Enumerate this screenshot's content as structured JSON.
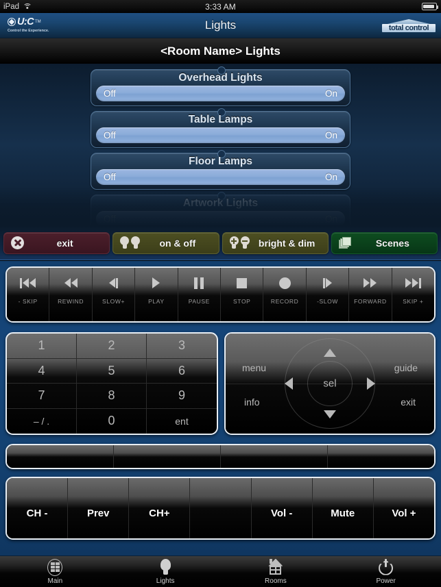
{
  "statusbar": {
    "device": "iPad",
    "time": "3:33 AM",
    "wifi_icon": "wifi-icon",
    "battery_icon": "battery-icon"
  },
  "titlebar": {
    "title": "Lights",
    "brand_letters": "U:C",
    "brand_tm": "TM",
    "brand_tagline": "Control the Experience.",
    "partner_logo_text": "total control"
  },
  "room_header": {
    "title": "<Room Name> Lights"
  },
  "lights": {
    "items": [
      {
        "name": "Overhead Lights",
        "off_label": "Off",
        "on_label": "On",
        "state": "normal"
      },
      {
        "name": "Table Lamps",
        "off_label": "Off",
        "on_label": "On",
        "state": "normal"
      },
      {
        "name": "Floor Lamps",
        "off_label": "Off",
        "on_label": "On",
        "state": "normal"
      },
      {
        "name": "Artwork Lights",
        "off_label": "Off",
        "on_label": "On",
        "state": "faded"
      }
    ]
  },
  "modebar": {
    "buttons": [
      {
        "label": "exit",
        "icon": "close-circle-icon",
        "color": "#4c1f2b"
      },
      {
        "label": "on & off",
        "icon": "two-bulbs-icon",
        "color": "#4d4f22"
      },
      {
        "label": "bright & dim",
        "icon": "bulb-plus-minus-icon",
        "color": "#4d4f22"
      },
      {
        "label": "Scenes",
        "icon": "stacked-pages-icon",
        "color": "#0e4d20"
      }
    ]
  },
  "transport": {
    "keys": [
      {
        "label": "- SKIP",
        "icon": "skip-back-icon"
      },
      {
        "label": "REWIND",
        "icon": "rewind-icon"
      },
      {
        "label": "SLOW+",
        "icon": "slow-forward-icon"
      },
      {
        "label": "PLAY",
        "icon": "play-icon"
      },
      {
        "label": "PAUSE",
        "icon": "pause-icon"
      },
      {
        "label": "STOP",
        "icon": "stop-icon"
      },
      {
        "label": "RECORD",
        "icon": "record-icon"
      },
      {
        "label": "-SLOW",
        "icon": "slow-reverse-icon"
      },
      {
        "label": "FORWARD",
        "icon": "fast-forward-icon"
      },
      {
        "label": "SKIP +",
        "icon": "skip-forward-icon"
      }
    ]
  },
  "keypad": {
    "keys": [
      "1",
      "2",
      "3",
      "4",
      "5",
      "6",
      "7",
      "8",
      "9",
      "– / .",
      "0",
      "ent"
    ]
  },
  "dpad": {
    "center": "sel",
    "menu": "menu",
    "guide": "guide",
    "info": "info",
    "exit": "exit",
    "up_icon": "arrow-up-icon",
    "down_icon": "arrow-down-icon",
    "left_icon": "arrow-left-icon",
    "right_icon": "arrow-right-icon"
  },
  "blankbar": {
    "keys": [
      "",
      "",
      "",
      ""
    ]
  },
  "chbar": {
    "keys": [
      "CH -",
      "Prev",
      "CH+",
      "",
      "Vol -",
      "Mute",
      "Vol +"
    ]
  },
  "tabbar": {
    "tabs": [
      {
        "label": "Main",
        "icon": "grid-circle-icon",
        "active": false
      },
      {
        "label": "Lights",
        "icon": "bulb-icon",
        "active": true
      },
      {
        "label": "Rooms",
        "icon": "house-icon",
        "active": false
      },
      {
        "label": "Power",
        "icon": "power-icon",
        "active": false
      }
    ]
  },
  "colors": {
    "title_bar": "#1a456f",
    "remote_bg": "#16477c",
    "slider_fill": "#8bacd9",
    "exit_red": "#4c1f2b",
    "olive": "#4d4f22",
    "scene_green": "#0e4d20"
  }
}
